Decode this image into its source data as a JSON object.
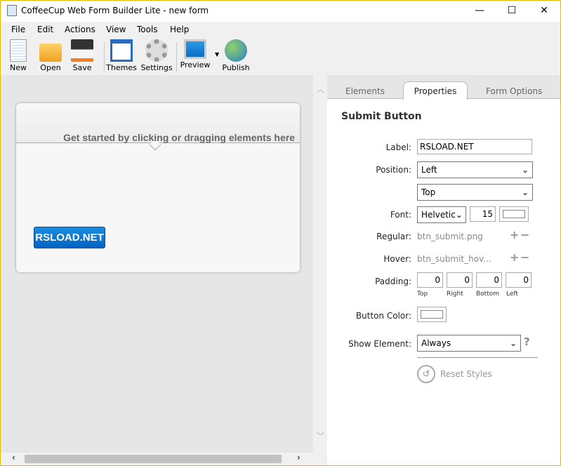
{
  "window": {
    "title": "CoffeeCup Web Form Builder Lite - new form",
    "minimize": "—",
    "maximize": "☐",
    "close": "✕"
  },
  "menu": [
    "File",
    "Edit",
    "Actions",
    "View",
    "Tools",
    "Help"
  ],
  "toolbar": {
    "new": "New",
    "open": "Open",
    "save": "Save",
    "themes": "Themes",
    "settings": "Settings",
    "preview": "Preview",
    "publish": "Publish"
  },
  "canvas": {
    "hint": "Get started by clicking or dragging elements here",
    "submit_label": "RSLOAD.NET"
  },
  "tabs": {
    "elements": "Elements",
    "properties": "Properties",
    "form_options": "Form Options"
  },
  "properties": {
    "title": "Submit Button",
    "label_label": "Label:",
    "label_value": "RSLOAD.NET",
    "position_label": "Position:",
    "position_h": "Left",
    "position_v": "Top",
    "font_label": "Font:",
    "font_family": "Helvetic",
    "font_size": "15",
    "regular_label": "Regular:",
    "regular_value": "btn_submit.png",
    "hover_label": "Hover:",
    "hover_value": "btn_submit_hov...",
    "padding_label": "Padding:",
    "padding": {
      "top": "0",
      "right": "0",
      "bottom": "0",
      "left": "0"
    },
    "padding_captions": {
      "top": "Top",
      "right": "Right",
      "bottom": "Bottom",
      "left": "Left"
    },
    "button_color_label": "Button Color:",
    "show_element_label": "Show Element:",
    "show_element_value": "Always",
    "help": "?",
    "reset": "Reset Styles"
  },
  "colors": {
    "submit": "#0a74d4",
    "window_border": "#e6b800"
  }
}
